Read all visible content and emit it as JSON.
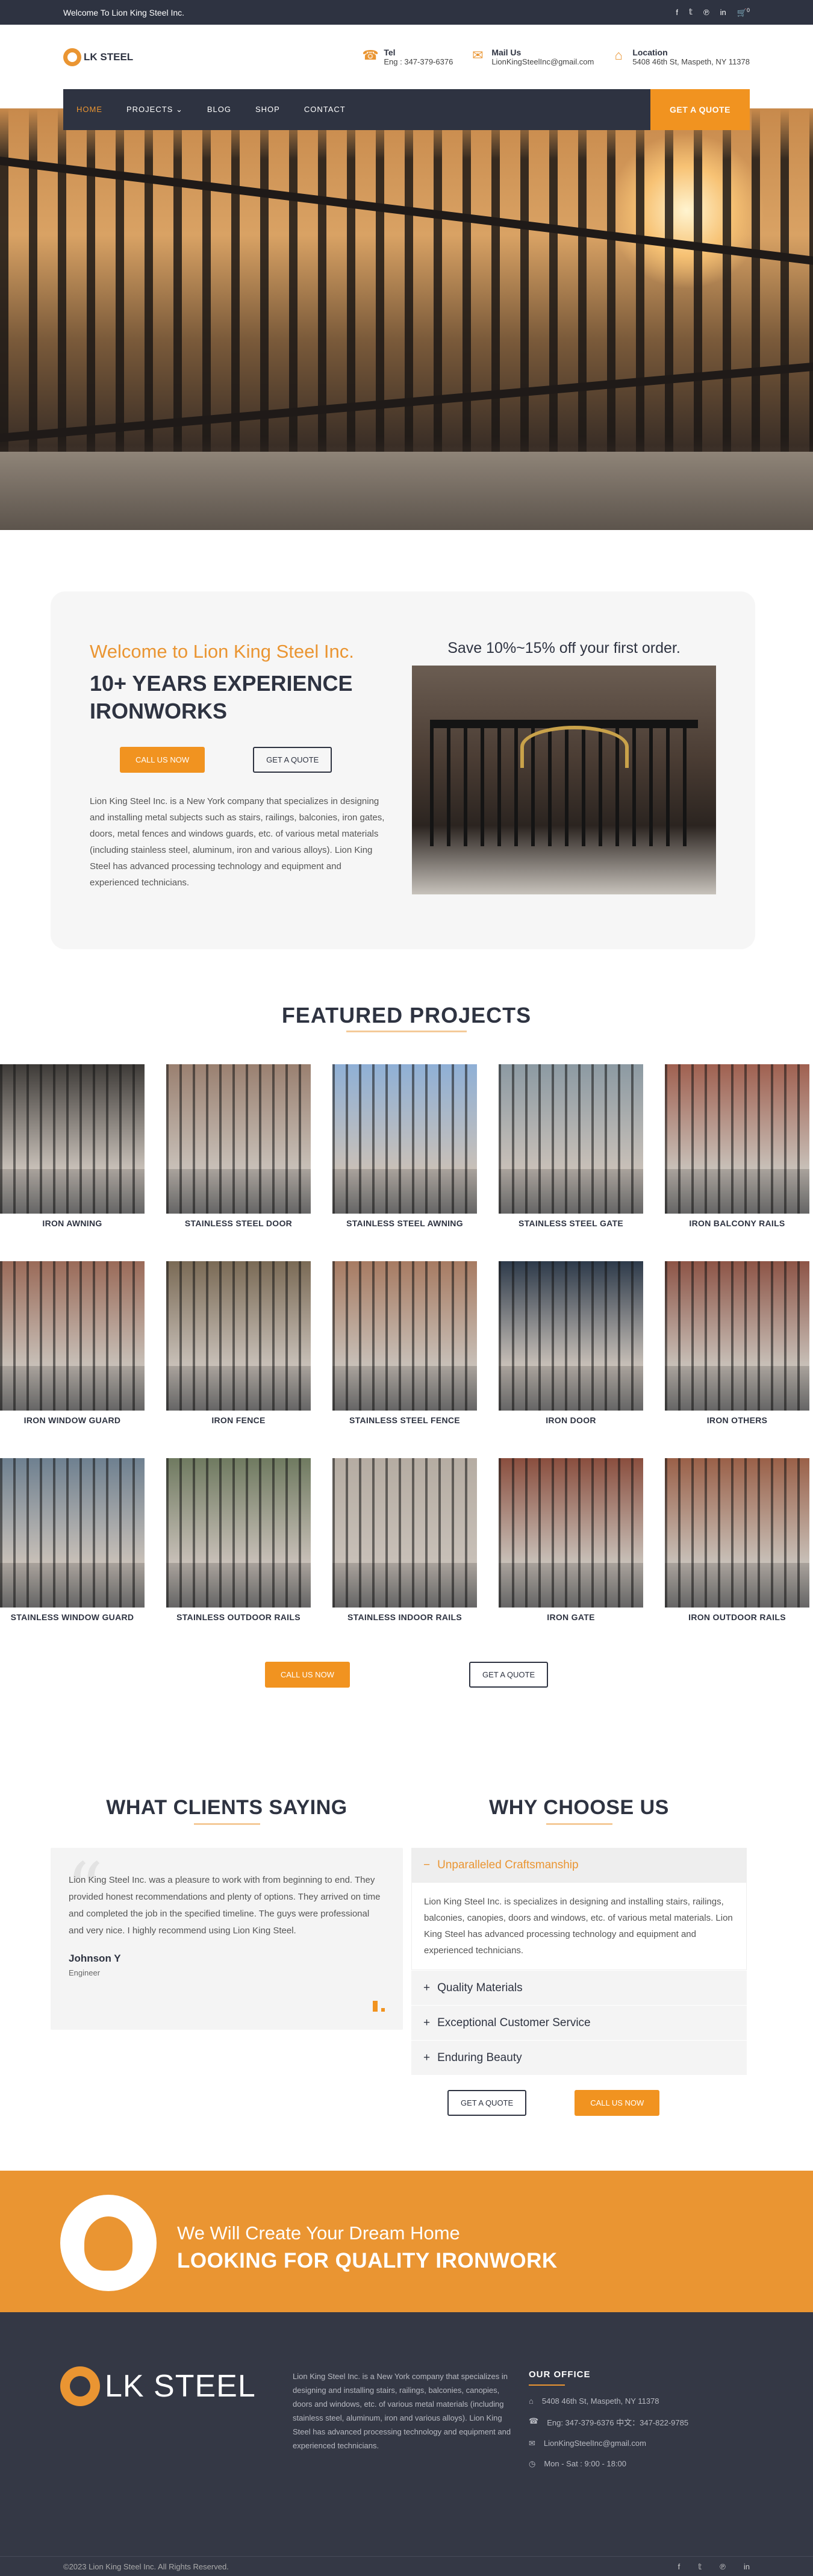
{
  "topbar": {
    "welcome": "Welcome To Lion King Steel Inc.",
    "socials": [
      "facebook-icon",
      "twitter-icon",
      "pinterest-icon",
      "linkedin-icon",
      "cart-icon"
    ],
    "cart_count": "0"
  },
  "header": {
    "logo_text": "LK STEEL",
    "contacts": [
      {
        "icon": "phone-icon",
        "label": "Tel",
        "value": "Eng : 347-379-6376"
      },
      {
        "icon": "mail-icon",
        "label": "Mail Us",
        "value": "LionKingSteelInc@gmail.com"
      },
      {
        "icon": "location-icon",
        "label": "Location",
        "value": "5408 46th St, Maspeth, NY 11378"
      }
    ]
  },
  "nav": {
    "items": [
      "HOME",
      "PROJECTS",
      "BLOG",
      "SHOP",
      "CONTACT"
    ],
    "active": "HOME",
    "quote_label": "GET A QUOTE"
  },
  "welcome": {
    "title": "Welcome to Lion King Steel Inc.",
    "subtitle": "10+ YEARS EXPERIENCE IRONWORKS",
    "call_label": "CALL US NOW",
    "quote_label": "GET A QUOTE",
    "text": "Lion King Steel Inc. is a New York company that specializes in designing and installing metal subjects such as stairs, railings, balconies, iron gates, doors, metal fences and windows guards, etc. of various metal materials (including stainless steel, aluminum, iron and various alloys). Lion King Steel has advanced processing technology and equipment and experienced technicians.",
    "promo": "Save 10%~15% off your first order."
  },
  "featured": {
    "title": "FEATURED PROJECTS",
    "projects": [
      {
        "caption": "IRON AWNING",
        "color": "#3d3a37"
      },
      {
        "caption": "STAINLESS STEEL DOOR",
        "color": "#9a8070"
      },
      {
        "caption": "STAINLESS STEEL AWNING",
        "color": "#8fb0d6"
      },
      {
        "caption": "STAINLESS STEEL GATE",
        "color": "#8c9aa3"
      },
      {
        "caption": "IRON BALCONY RAILS",
        "color": "#a06050"
      },
      {
        "caption": "IRON WINDOW GUARD",
        "color": "#9a6a58"
      },
      {
        "caption": "IRON FENCE",
        "color": "#7a6a55"
      },
      {
        "caption": "STAINLESS STEEL FENCE",
        "color": "#a77b62"
      },
      {
        "caption": "IRON DOOR",
        "color": "#2d3a4a"
      },
      {
        "caption": "IRON OTHERS",
        "color": "#8d5446"
      },
      {
        "caption": "STAINLESS WINDOW GUARD",
        "color": "#6e8090"
      },
      {
        "caption": "STAINLESS OUTDOOR RAILS",
        "color": "#6f7a60"
      },
      {
        "caption": "STAINLESS INDOOR RAILS",
        "color": "#b5aca2"
      },
      {
        "caption": "IRON GATE",
        "color": "#8a4e3e"
      },
      {
        "caption": "IRON OUTDOOR RAILS",
        "color": "#9a6048"
      }
    ],
    "call_label": "CALL US NOW",
    "quote_label": "GET A QUOTE"
  },
  "clients": {
    "title": "WHAT CLIENTS SAYING",
    "quote": "Lion King Steel Inc. was a pleasure to work with from beginning to end. They provided honest recommendations and plenty of options. They arrived on time and completed the job in the specified timeline. The guys were professional and very nice. I highly recommend using Lion King Steel.",
    "name": "Johnson Y",
    "role": "Engineer"
  },
  "why": {
    "title": "WHY CHOOSE US",
    "items": [
      {
        "label": "Unparalleled Craftsmanship",
        "open": true,
        "sign": "−"
      },
      {
        "label": "Quality Materials",
        "open": false,
        "sign": "+"
      },
      {
        "label": "Exceptional Customer Service",
        "open": false,
        "sign": "+"
      },
      {
        "label": "Enduring Beauty",
        "open": false,
        "sign": "+"
      }
    ],
    "open_text": "Lion King Steel Inc. is specializes in designing and installing stairs, railings, balconies, canopies, doors and windows, etc. of various metal materials. Lion King Steel has advanced processing technology and equipment and experienced technicians.",
    "quote_label": "GET A QUOTE",
    "call_label": "CALL US NOW"
  },
  "banner": {
    "line1": "We Will Create Your Dream Home",
    "line2": "LOOKING FOR QUALITY IRONWORK"
  },
  "footer": {
    "logo_text": "LK STEEL",
    "about": "Lion King Steel Inc. is a New York company that specializes in designing and installing stairs, railings, balconies, canopies, doors and windows, etc. of various metal materials (including stainless steel, aluminum, iron and various alloys). Lion King Steel has advanced processing technology and equipment and experienced technicians.",
    "office_title": "OUR OFFICE",
    "office_lines": [
      {
        "icon": "location-icon",
        "text": "5408 46th St, Maspeth, NY 11378"
      },
      {
        "icon": "phone-icon",
        "text": "Eng: 347-379-6376 中文：347-822-9785"
      },
      {
        "icon": "mail-icon",
        "text": "LionKingSteelInc@gmail.com"
      },
      {
        "icon": "clock-icon",
        "text": "Mon - Sat : 9:00 - 18:00"
      }
    ],
    "copyright": "©2023 Lion King Steel Inc. All Rights Reserved.",
    "socials": [
      "facebook-icon",
      "twitter-icon",
      "pinterest-icon",
      "linkedin-icon"
    ]
  },
  "colors": {
    "accent": "#ea9532",
    "dark": "#2e3341",
    "footer": "#343845"
  }
}
